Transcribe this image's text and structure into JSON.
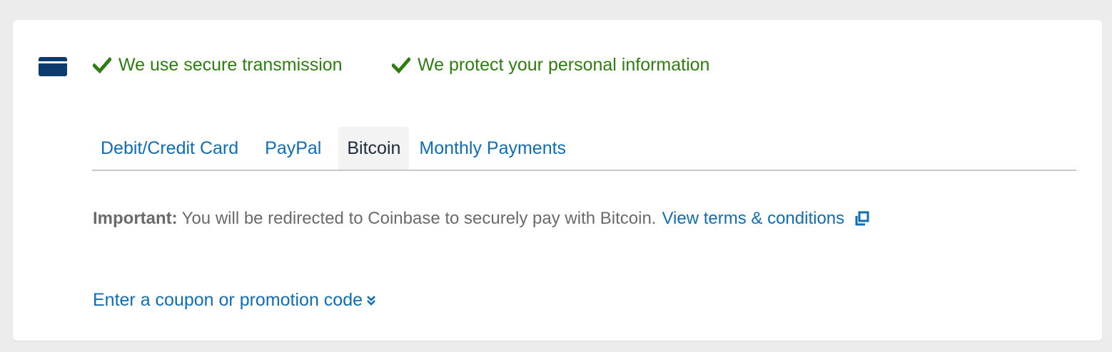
{
  "assurances": [
    {
      "label": "We use secure transmission",
      "icon": "check-icon"
    },
    {
      "label": "We protect your personal information",
      "icon": "check-icon"
    }
  ],
  "payment_tabs": [
    {
      "label": "Debit/Credit Card",
      "active": false
    },
    {
      "label": "PayPal",
      "active": false
    },
    {
      "label": "Bitcoin",
      "active": true
    },
    {
      "label": "Monthly Payments",
      "active": false
    }
  ],
  "notice": {
    "important_label": "Important:",
    "message": "You will be redirected to Coinbase to securely pay with Bitcoin.",
    "terms_link": "View terms & conditions",
    "terms_icon": "external-link-icon"
  },
  "coupon": {
    "label": "Enter a coupon or promotion code",
    "icon": "double-chevron-down-icon"
  },
  "colors": {
    "accent_link": "#0e6db5",
    "success_green": "#2e7d0f",
    "card_icon": "#0d3b6e",
    "page_bg": "#ececec"
  }
}
